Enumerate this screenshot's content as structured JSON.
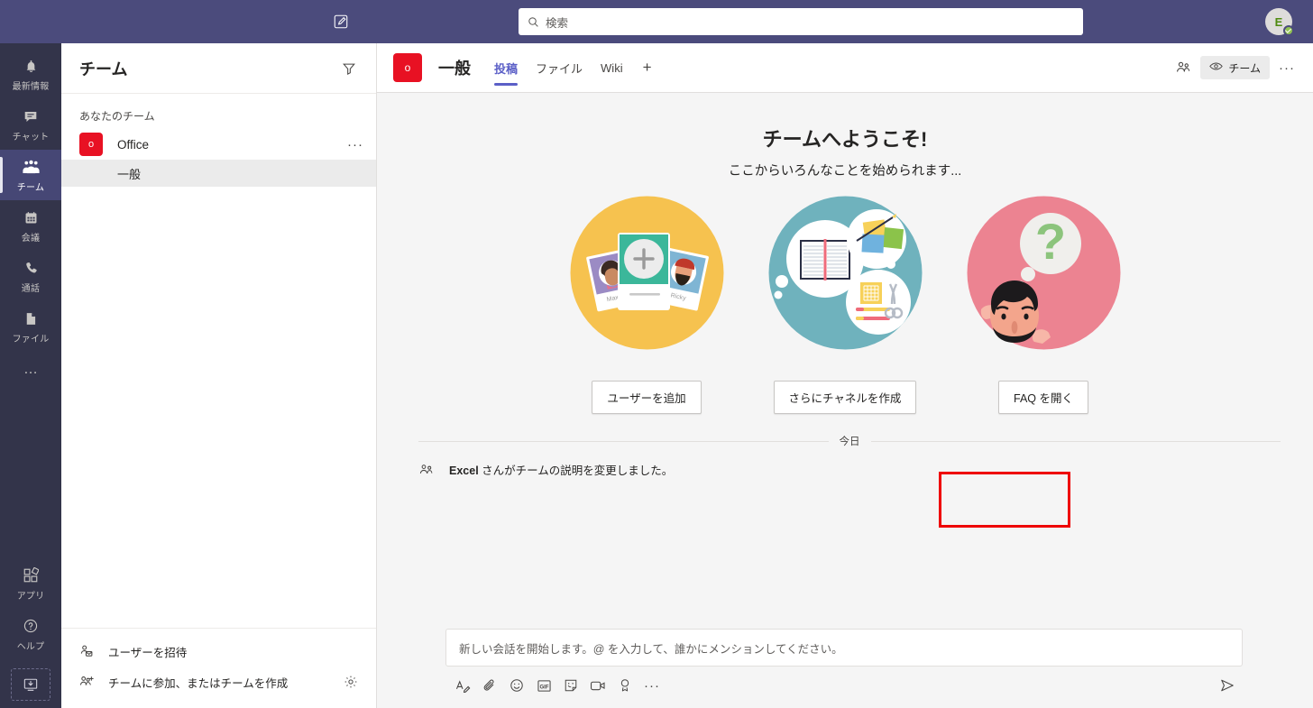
{
  "topbar": {
    "compose_icon": "compose-icon",
    "search": {
      "placeholder": "検索",
      "icon": "search-icon"
    },
    "avatar": {
      "initial": "E",
      "presence": "available"
    }
  },
  "rail": {
    "items": [
      {
        "label": "最新情報",
        "icon": "bell-icon",
        "active": false
      },
      {
        "label": "チャット",
        "icon": "chat-icon",
        "active": false
      },
      {
        "label": "チーム",
        "icon": "teams-icon",
        "active": true
      },
      {
        "label": "会議",
        "icon": "calendar-icon",
        "active": false
      },
      {
        "label": "通話",
        "icon": "phone-icon",
        "active": false
      },
      {
        "label": "ファイル",
        "icon": "file-icon",
        "active": false
      }
    ],
    "more_label": "…",
    "bottom": [
      {
        "label": "アプリ",
        "icon": "apps-icon"
      },
      {
        "label": "ヘルプ",
        "icon": "help-icon"
      }
    ],
    "download_icon": "download-desktop-icon"
  },
  "pane": {
    "title": "チーム",
    "filter_icon": "filter-icon",
    "group_label": "あなたのチーム",
    "teams": [
      {
        "name": "Office",
        "avatar_letter": "o",
        "avatar_color": "#e81123",
        "more": "···",
        "channels": [
          {
            "name": "一般",
            "selected": true
          }
        ]
      }
    ],
    "footer": [
      {
        "label": "ユーザーを招待",
        "icon": "invite-person-icon"
      },
      {
        "label": "チームに参加、またはチームを作成",
        "icon": "join-team-icon"
      }
    ],
    "gear_icon": "gear-icon"
  },
  "channel_header": {
    "avatar_letter": "o",
    "title": "一般",
    "tabs": [
      {
        "label": "投稿",
        "active": true
      },
      {
        "label": "ファイル",
        "active": false
      },
      {
        "label": "Wiki",
        "active": false
      }
    ],
    "add_tab": "+",
    "members_icon": "people-icon",
    "team_pill": {
      "label": "チーム",
      "icon": "eye-icon"
    },
    "more": "···"
  },
  "welcome": {
    "title": "チームへようこそ!",
    "subtitle": "ここからいろんなことを始められます...",
    "cards": [
      {
        "illustration": "add-members-illustration",
        "cta": "ユーザーを追加",
        "highlighted": true
      },
      {
        "illustration": "create-channels-illustration",
        "cta": "さらにチャネルを作成",
        "highlighted": false
      },
      {
        "illustration": "faq-illustration",
        "cta": "FAQ を開く",
        "highlighted": false
      }
    ]
  },
  "conversation": {
    "date_divider": "今日",
    "system_message": {
      "icon": "team-update-icon",
      "actor": "Excel",
      "text": " さんがチームの説明を変更しました。"
    }
  },
  "compose": {
    "placeholder": "新しい会話を開始します。@ を入力して、誰かにメンションしてください。",
    "tools": [
      {
        "name": "format-icon"
      },
      {
        "name": "attach-icon"
      },
      {
        "name": "emoji-icon"
      },
      {
        "name": "giphy-icon"
      },
      {
        "name": "sticker-icon"
      },
      {
        "name": "meet-now-icon"
      },
      {
        "name": "praise-icon"
      },
      {
        "name": "more-options-icon"
      }
    ],
    "more": "···",
    "send_icon": "send-icon"
  },
  "colors": {
    "topbar": "#4b4b7c",
    "rail": "#33344a",
    "rail_active": "#464775",
    "accent": "#5b5fc7",
    "team_red": "#e81123",
    "highlight": "#ee0000",
    "content_bg": "#f5f5f5"
  }
}
